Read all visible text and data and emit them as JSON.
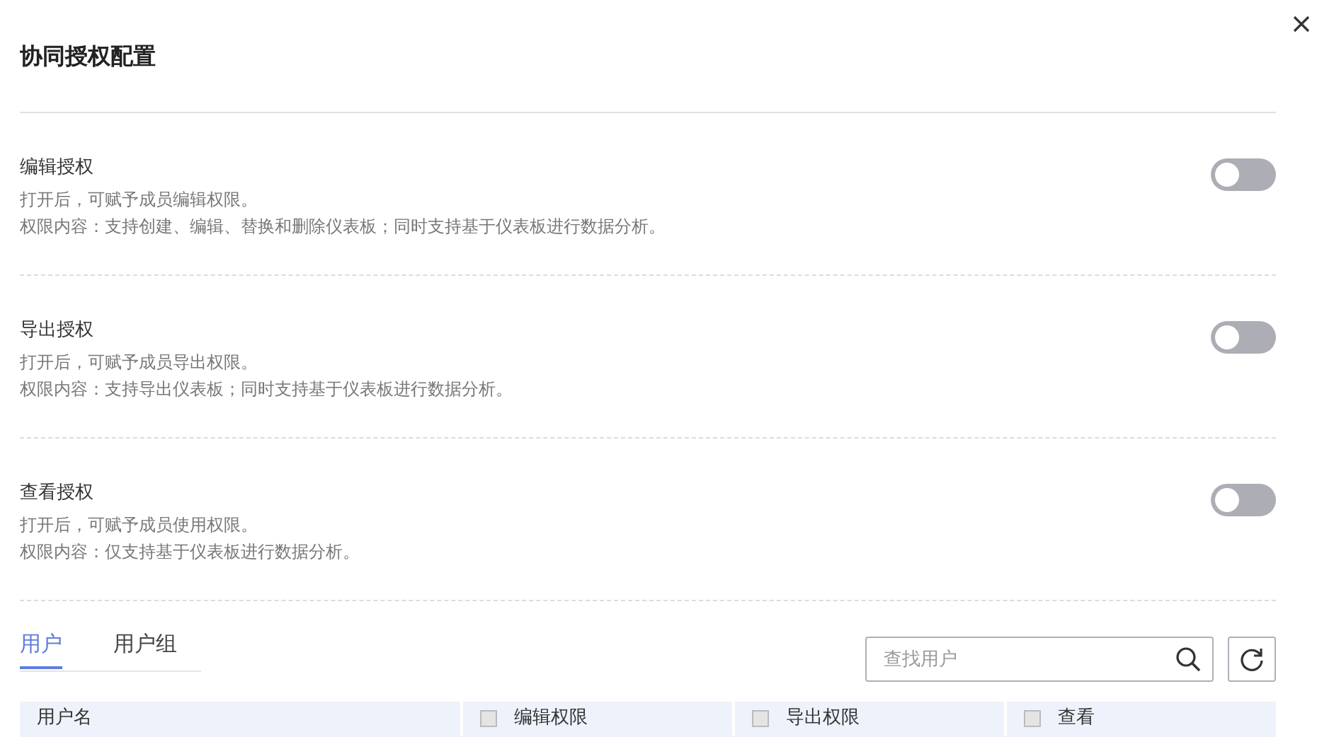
{
  "dialog": {
    "title": "协同授权配置"
  },
  "permissions": [
    {
      "title": "编辑授权",
      "lines": [
        "打开后，可赋予成员编辑权限。",
        "权限内容：支持创建、编辑、替换和删除仪表板；同时支持基于仪表板进行数据分析。"
      ],
      "on": false
    },
    {
      "title": "导出授权",
      "lines": [
        "打开后，可赋予成员导出权限。",
        "权限内容：支持导出仪表板；同时支持基于仪表板进行数据分析。"
      ],
      "on": false
    },
    {
      "title": "查看授权",
      "lines": [
        "打开后，可赋予成员使用权限。",
        "权限内容：仅支持基于仪表板进行数据分析。"
      ],
      "on": false
    }
  ],
  "tabs": [
    {
      "label": "用户",
      "selected": true
    },
    {
      "label": "用户组",
      "selected": false
    }
  ],
  "search": {
    "placeholder": "查找用户"
  },
  "table": {
    "columns": [
      {
        "label": "用户名"
      },
      {
        "label": "编辑权限",
        "checked": false
      },
      {
        "label": "导出权限",
        "checked": false
      },
      {
        "label": "查看",
        "checked": false
      }
    ]
  }
}
